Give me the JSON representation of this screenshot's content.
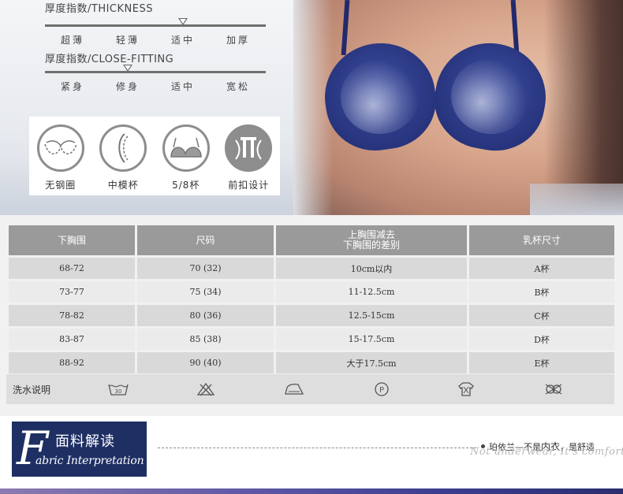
{
  "indices": {
    "thickness": {
      "title": "厚度指数/THICKNESS",
      "levels": [
        "超薄",
        "轻薄",
        "适中",
        "加厚"
      ],
      "selected_index": 2
    },
    "fitting": {
      "title": "厚度指数/CLOSE-FITTING",
      "levels": [
        "紧身",
        "修身",
        "适中",
        "宽松"
      ],
      "selected_index": 1
    }
  },
  "features": [
    {
      "label": "无钢圈",
      "icon": "wireless-bra-icon"
    },
    {
      "label": "中模杯",
      "icon": "mold-cup-icon"
    },
    {
      "label": "5/8杯",
      "icon": "five-eighths-cup-icon"
    },
    {
      "label": "前扣设计",
      "icon": "front-closure-icon"
    }
  ],
  "size_table": {
    "headers": [
      "下胸围",
      "尺码",
      "上胸围减去\n下胸围的差别",
      "乳杯尺寸"
    ],
    "header_lines": [
      [
        "下胸围"
      ],
      [
        "尺码"
      ],
      [
        "上胸围减去",
        "下胸围的差别"
      ],
      [
        "乳杯尺寸"
      ]
    ],
    "rows": [
      [
        "68-72",
        "70 (32)",
        "10cm以内",
        "A杯"
      ],
      [
        "73-77",
        "75 (34)",
        "11-12.5cm",
        "B杯"
      ],
      [
        "78-82",
        "80 (36)",
        "12.5-15cm",
        "C杯"
      ],
      [
        "83-87",
        "85 (38)",
        "15-17.5cm",
        "D杯"
      ],
      [
        "88-92",
        "90 (40)",
        "大于17.5cm",
        "E杯"
      ]
    ]
  },
  "wash": {
    "label": "洗水说明",
    "icons": [
      {
        "name": "wash-30-icon",
        "text": "30"
      },
      {
        "name": "no-bleach-icon"
      },
      {
        "name": "low-iron-icon"
      },
      {
        "name": "dry-clean-p-icon",
        "text": "P"
      },
      {
        "name": "hang-dry-icon"
      },
      {
        "name": "no-tumble-dry-icon"
      }
    ]
  },
  "fabric": {
    "initial": "F",
    "title_cn": "面料解读",
    "title_en": "abric Interpretation",
    "slogan_prefix": "珀依兰—不是",
    "slogan_bold": "内衣",
    "slogan_suffix": "，是舒适",
    "slogan_en": "Not underwear, It's comfortable."
  },
  "colors": {
    "badge": "#1e2f63",
    "header_gray": "#9a9a9a",
    "icon_gray": "#8d8d8d"
  }
}
